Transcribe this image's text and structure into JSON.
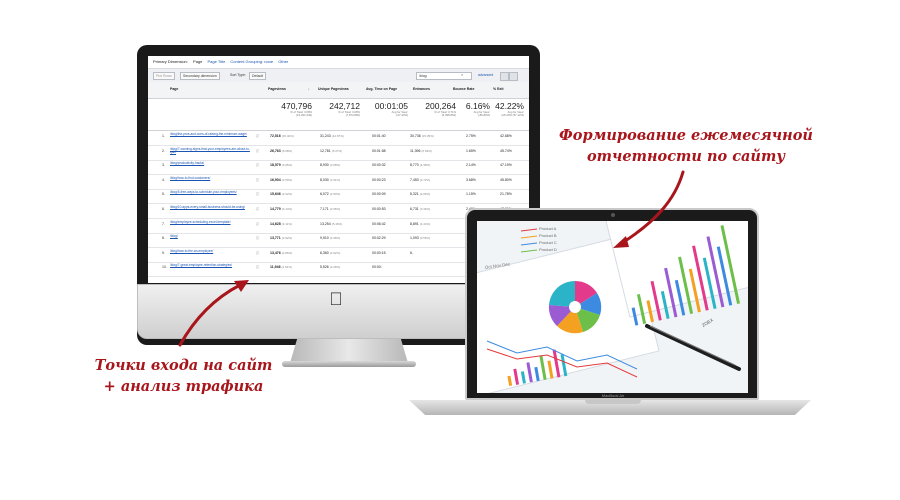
{
  "imac": {
    "logo_icon": "apple-logo-icon",
    "analytics": {
      "primary_dimension_label": "Primary Dimension:",
      "dimension_options": [
        "Page",
        "Page Title",
        "Content Grouping: none",
        "Other"
      ],
      "toolbar": {
        "plot_rows": "Plot Rows",
        "secondary_dimension": "Secondary dimension",
        "sort_type_label": "Sort Type:",
        "sort_type_value": "Default",
        "search_value": "/blog",
        "advanced": "advanced"
      },
      "columns": [
        "Page",
        "Pageviews",
        "Unique Pageviews",
        "Avg. Time on Page",
        "Entrances",
        "Bounce Rate",
        "% Exit"
      ],
      "totals": [
        {
          "big": "470,796",
          "line1": "% of Total: 3.08%",
          "line2": "(15,293,449)"
        },
        {
          "big": "242,712",
          "line1": "% of Total: 3.08%",
          "line2": "(7,874,860)"
        },
        {
          "big": "00:01:05",
          "line1": "Avg for View:",
          "line2": "(-67.40%)"
        },
        {
          "big": "200,264",
          "line1": "% of Total: 3.71%",
          "line2": "(5,398,864)"
        },
        {
          "big": "6.16%",
          "line1": "Avg for View:",
          "line2": "(-89.80%)"
        },
        {
          "big": "42.22%",
          "line1": "Avg for View:",
          "line2": "(26.30% (57.12%)"
        }
      ],
      "rows": [
        {
          "n": "1.",
          "page": "/blog/the-pros-and-cons-of-raising-the-minimum-wage/",
          "pv": "72,516",
          "pv_pct": "(15.40%)",
          "upv": "31,243",
          "upv_pct": "(12.87%)",
          "time": "00:01:40",
          "ent": "30,736",
          "ent_pct": "(15.35%)",
          "bounce": "2.75%",
          "exit": "42.68%"
        },
        {
          "n": "2.",
          "page": "/blog/7-warning-signs-that-your-employees-are-about-to-quit/",
          "pv": "26,763",
          "pv_pct": "(5.68%)",
          "upv": "12,781",
          "upv_pct": "(5.27%)",
          "time": "00:01:58",
          "ent": "11,396",
          "ent_pct": "(5.69%)",
          "bounce": "1.65%",
          "exit": "45.74%"
        },
        {
          "n": "3.",
          "page": "/blog/productivity-hacks/",
          "pv": "18,579",
          "pv_pct": "(3.95%)",
          "upv": "8,930",
          "upv_pct": "(3.68%)",
          "time": "00:00:32",
          "ent": "8,770",
          "ent_pct": "(4.38%)",
          "bounce": "2.14%",
          "exit": "47.19%"
        },
        {
          "n": "4.",
          "page": "/blog/how-to-find-customers/",
          "pv": "16,904",
          "pv_pct": "(3.59%)",
          "upv": "8,030",
          "upv_pct": "(3.31%)",
          "time": "00:00:23",
          "ent": "7,453",
          "ent_pct": "(3.72%)",
          "bounce": "3.68%",
          "exit": "45.80%"
        },
        {
          "n": "5.",
          "page": "/blog/5-free-ways-to-schedule-your-employees/",
          "pv": "15,646",
          "pv_pct": "(3.32%)",
          "upv": "6,072",
          "upv_pct": "(2.50%)",
          "time": "00:00:09",
          "ent": "5,321",
          "ent_pct": "(2.66%)",
          "bounce": "1.15%",
          "exit": "21.78%"
        },
        {
          "n": "6.",
          "page": "/blog/10-apps-every-small-business-should-be-using/",
          "pv": "14,779",
          "pv_pct": "(3.14%)",
          "upv": "7,171",
          "upv_pct": "(2.95%)",
          "time": "00:00:53",
          "ent": "6,731",
          "ent_pct": "(3.36%)",
          "bounce": "2.49%",
          "exit": "47.26%"
        },
        {
          "n": "7.",
          "page": "/blog/employee-scheduling-excel-template/",
          "pv": "14,628",
          "pv_pct": "(3.11%)",
          "upv": "13,254",
          "upv_pct": "(5.46%)",
          "time": "00:06:42",
          "ent": "8,891",
          "ent_pct": "(4.44%)",
          "bounce": "0.05%",
          "exit": ""
        },
        {
          "n": "8.",
          "page": "/blog/",
          "pv": "13,771",
          "pv_pct": "(2.92%)",
          "upv": "9,910",
          "upv_pct": "(4.08%)",
          "time": "00:02:29",
          "ent": "1,093",
          "ent_pct": "(0.55%)",
          "bounce": "",
          "exit": ""
        },
        {
          "n": "9.",
          "page": "/blog/how-to-fire-an-employee/",
          "pv": "13,476",
          "pv_pct": "(2.86%)",
          "upv": "6,360",
          "upv_pct": "(2.62%)",
          "time": "00:00:15",
          "ent": "6,",
          "ent_pct": "",
          "bounce": "",
          "exit": ""
        },
        {
          "n": "10.",
          "page": "/blog/7-great-employee-retention-strategies/",
          "pv": "11,946",
          "pv_pct": "(2.54%)",
          "upv": "5,526",
          "upv_pct": "(2.28%)",
          "time": "00:00:",
          "ent": "",
          "ent_pct": "",
          "bounce": "",
          "exit": ""
        }
      ]
    }
  },
  "macbook": {
    "brand_label": "MacBook Air",
    "screen_legend": [
      "Product A",
      "Product B",
      "Product C",
      "Product D"
    ],
    "screen_months": "Oct Nov Dec",
    "screen_text": "ZOEX"
  },
  "annotations": {
    "right": [
      "Формирование ежемесячной",
      "отчетности по сайту"
    ],
    "left": [
      "Точки входа на сайт",
      "+ анализ трафика"
    ],
    "accent_color": "#a8161c"
  }
}
